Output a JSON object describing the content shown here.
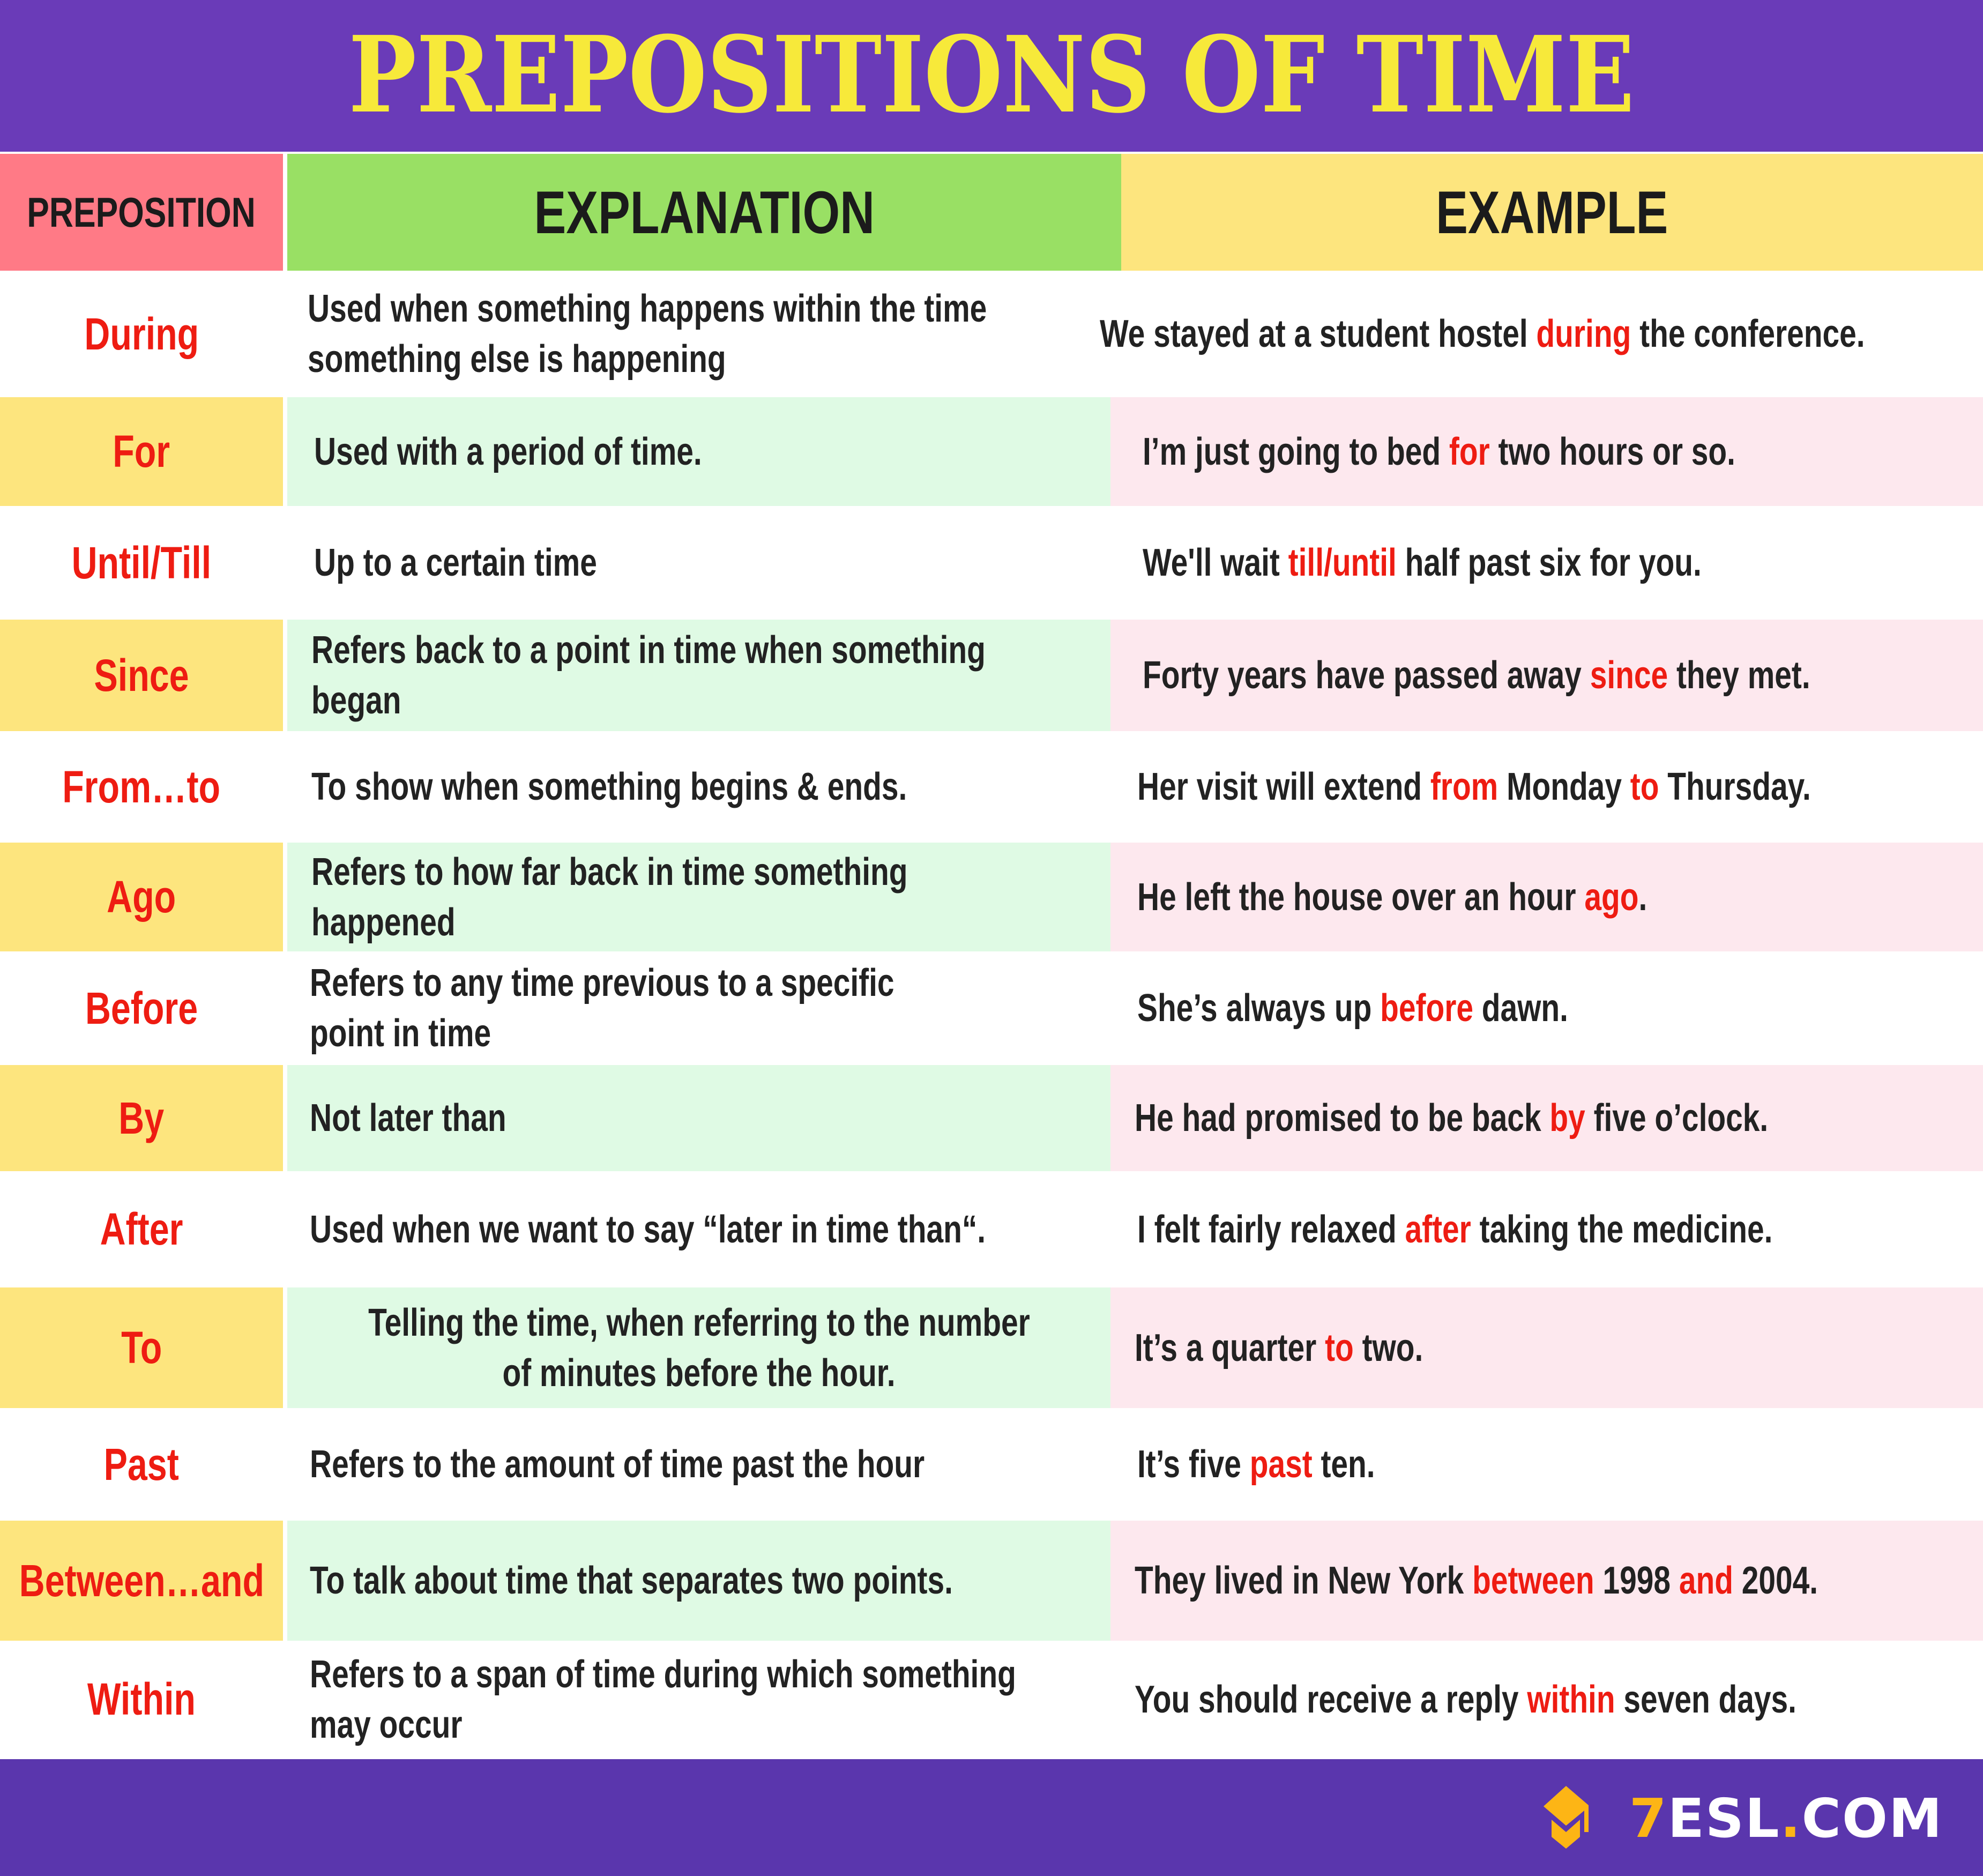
{
  "title": "PREPOSITIONS OF TIME",
  "columns": {
    "preposition": "PREPOSITION",
    "explanation": "EXPLANATION",
    "example": "EXAMPLE"
  },
  "colors": {
    "header_bg": "#6a3bb8",
    "title": "#f7e93a",
    "col_preposition": "#ff7a86",
    "col_explanation": "#99e064",
    "col_example": "#fde57e",
    "alt_preposition": "#fde57e",
    "alt_explanation": "#dffae4",
    "alt_example": "#fde8ee",
    "highlight": "#ee1c12",
    "footer_bg": "#5a36ad",
    "logo_accent": "#fdb515"
  },
  "rows": [
    {
      "preposition": "During",
      "explanation": [
        "Used when something happens within the time",
        "something else is happening"
      ],
      "example": [
        {
          "t": "We stayed at a student hostel "
        },
        {
          "t": "during",
          "hl": true
        },
        {
          "t": " the conference."
        }
      ]
    },
    {
      "preposition": "For",
      "explanation": [
        "Used with a period of time."
      ],
      "example": [
        {
          "t": "I’m just going to bed "
        },
        {
          "t": "for",
          "hl": true
        },
        {
          "t": " two hours or so."
        }
      ]
    },
    {
      "preposition": "Until/Till",
      "explanation": [
        "Up to a certain time"
      ],
      "example": [
        {
          "t": "We'll wait "
        },
        {
          "t": "till/until",
          "hl": true
        },
        {
          "t": " half past six for you."
        }
      ]
    },
    {
      "preposition": "Since",
      "explanation": [
        "Refers back to a point in time when something",
        "began"
      ],
      "example": [
        {
          "t": "Forty years have passed away "
        },
        {
          "t": "since",
          "hl": true
        },
        {
          "t": " they met."
        }
      ]
    },
    {
      "preposition": "From…to",
      "explanation": [
        "To show when something begins & ends."
      ],
      "example": [
        {
          "t": "Her visit will extend "
        },
        {
          "t": "from",
          "hl": true
        },
        {
          "t": " Monday "
        },
        {
          "t": "to",
          "hl": true
        },
        {
          "t": " Thursday."
        }
      ]
    },
    {
      "preposition": "Ago",
      "explanation": [
        "Refers to how far back in time something",
        "happened"
      ],
      "example": [
        {
          "t": "He left the house over an hour "
        },
        {
          "t": "ago",
          "hl": true
        },
        {
          "t": "."
        }
      ]
    },
    {
      "preposition": "Before",
      "explanation": [
        "Refers to any time previous to a specific",
        "point in time"
      ],
      "example": [
        {
          "t": "She’s always up "
        },
        {
          "t": "before",
          "hl": true
        },
        {
          "t": " dawn."
        }
      ]
    },
    {
      "preposition": "By",
      "explanation": [
        "Not later than"
      ],
      "example": [
        {
          "t": "He had promised to be back "
        },
        {
          "t": "by",
          "hl": true
        },
        {
          "t": " five o’clock."
        }
      ]
    },
    {
      "preposition": "After",
      "explanation": [
        "Used when we want to say “later in time than“."
      ],
      "example": [
        {
          "t": "I felt fairly relaxed "
        },
        {
          "t": "after",
          "hl": true
        },
        {
          "t": " taking the medicine."
        }
      ]
    },
    {
      "preposition": "To",
      "explanation": [
        "Telling the time, when referring to the number",
        "of minutes before the hour."
      ],
      "example": [
        {
          "t": "It’s a quarter "
        },
        {
          "t": "to",
          "hl": true
        },
        {
          "t": " two."
        }
      ]
    },
    {
      "preposition": "Past",
      "explanation": [
        "Refers to the amount of time past the hour"
      ],
      "example": [
        {
          "t": "It’s five "
        },
        {
          "t": "past",
          "hl": true
        },
        {
          "t": " ten."
        }
      ]
    },
    {
      "preposition": "Between…and",
      "explanation": [
        "To talk about time that separates two points."
      ],
      "example": [
        {
          "t": "They lived in New York "
        },
        {
          "t": "between",
          "hl": true
        },
        {
          "t": " 1998 "
        },
        {
          "t": "and",
          "hl": true
        },
        {
          "t": " 2004."
        }
      ]
    },
    {
      "preposition": "Within",
      "explanation": [
        "Refers to a span of time during which something",
        "may occur"
      ],
      "example": [
        {
          "t": "You should receive a reply "
        },
        {
          "t": "within",
          "hl": true
        },
        {
          "t": " seven days."
        }
      ]
    }
  ],
  "footer": {
    "logo_icon": "graduation-cap-icon",
    "logo_text": {
      "seven": "7",
      "esl": "ESL",
      "dot": ".",
      "com": "COM"
    }
  }
}
